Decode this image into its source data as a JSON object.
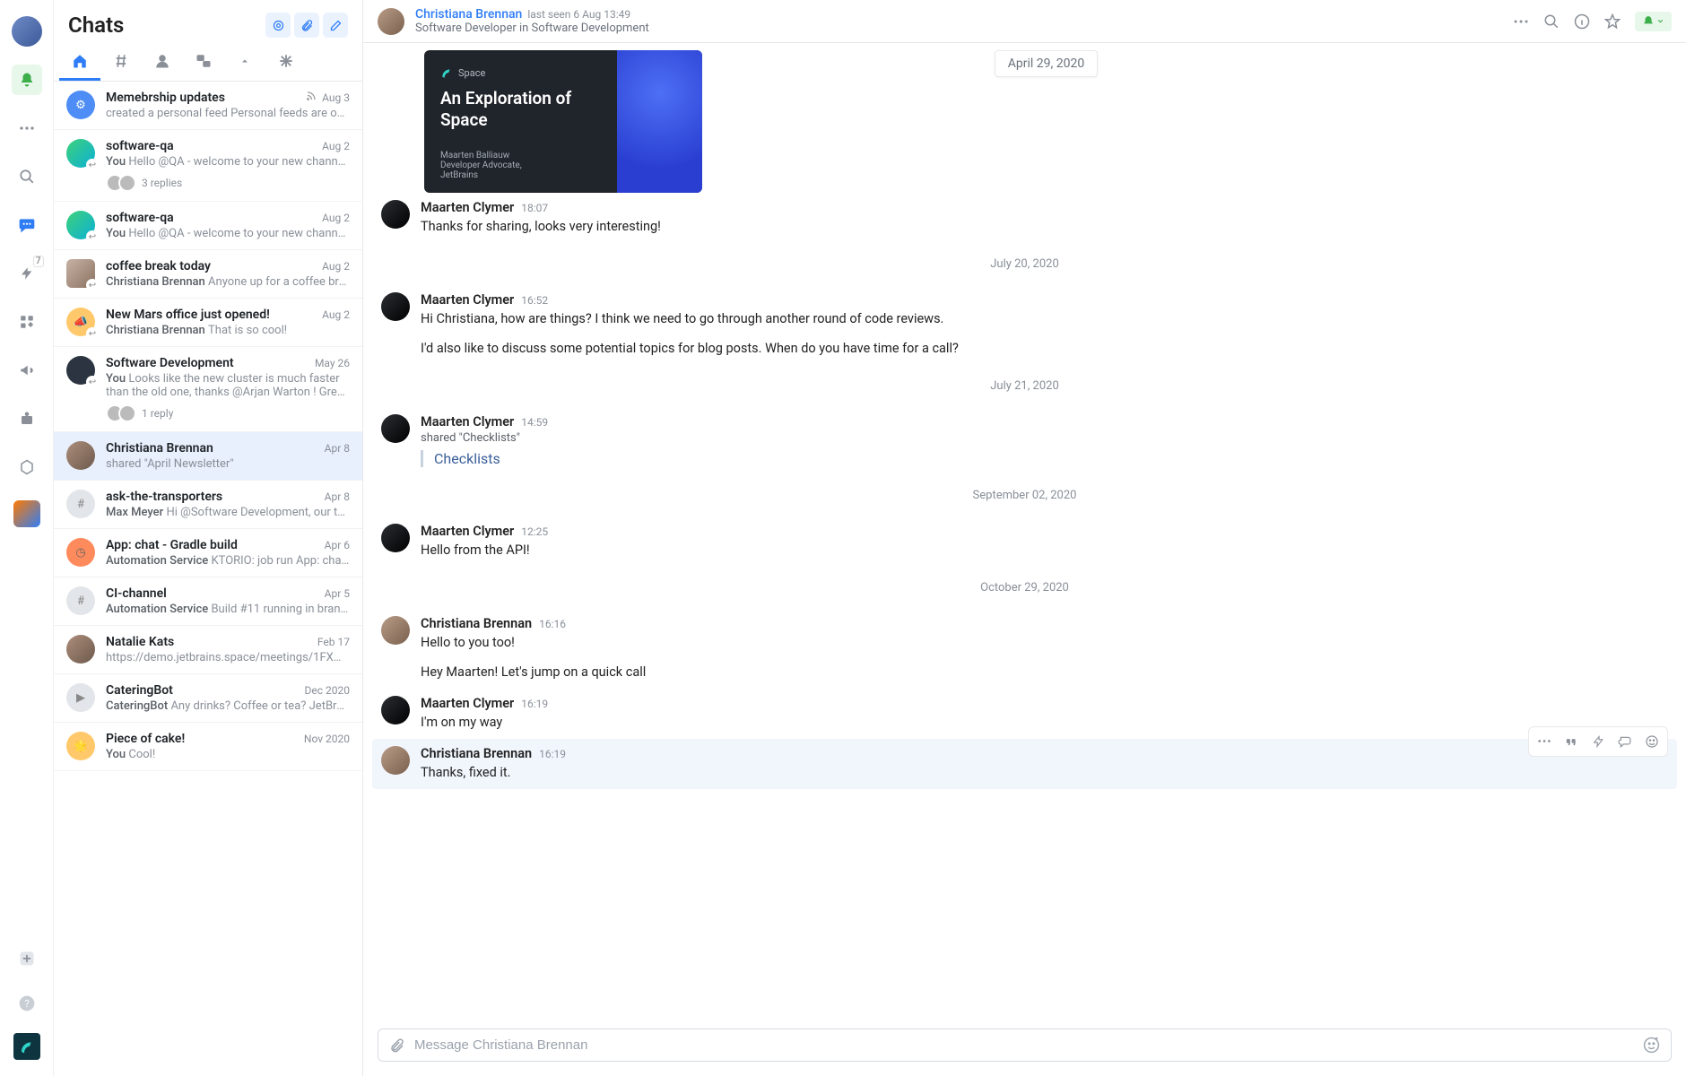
{
  "chatlist_title": "Chats",
  "rail": {
    "badge7": "7"
  },
  "tabs": [
    "home",
    "hash",
    "person",
    "group",
    "push",
    "asterisk"
  ],
  "chats": [
    {
      "title": "Memebrship updates",
      "date": "Aug 3",
      "rss": true,
      "snippet_author": "",
      "snippet": "created a personal feed Personal feeds are only…",
      "avatar": "blue",
      "icon": "⚙"
    },
    {
      "title": "software-qa",
      "date": "Aug 2",
      "snippet_author": "You",
      "snippet": "Hello @QA - welcome to your new channel!",
      "avatar": "green",
      "replies": "3 replies",
      "rep_avs": 2,
      "arrow": true
    },
    {
      "title": "software-qa",
      "date": "Aug 2",
      "snippet_author": "You",
      "snippet": "Hello @QA - welcome to your new channel!",
      "avatar": "green",
      "arrow": true
    },
    {
      "title": "coffee break today",
      "date": "Aug 2",
      "snippet_author": "Christiana Brennan",
      "snippet": "Anyone up for a coffee brea…",
      "avatar": "multi",
      "arrow": true
    },
    {
      "title": "New Mars office just opened!",
      "date": "Aug 2",
      "snippet_author": "Christiana Brennan",
      "snippet": "That is so cool!",
      "avatar": "orange",
      "icon": "📣",
      "arrow": true
    },
    {
      "title": "Software Development",
      "date": "May 26",
      "snippet_author": "You",
      "snippet": "Looks like the new cluster is much faster than the old one, thanks @Arjan Warton ! Great job!",
      "avatar": "dark",
      "replies": "1 reply",
      "rep_avs": 2,
      "arrow": true,
      "multiline": true
    },
    {
      "title": "Christiana Brennan",
      "date": "Apr 8",
      "snippet_author": "",
      "snippet": "shared \"April Newsletter\"",
      "avatar": "person",
      "selected": true
    },
    {
      "title": "ask-the-transporters",
      "date": "Apr 8",
      "snippet_author": "Max Meyer",
      "snippet": "Hi @Software Development, our tea…",
      "avatar": "gray",
      "icon": "#"
    },
    {
      "title": "App: chat - Gradle build",
      "date": "Apr 6",
      "snippet_author": "Automation Service",
      "snippet": "KTORIO: job run App: chat …",
      "avatar": "red",
      "icon": "◷"
    },
    {
      "title": "CI-channel",
      "date": "Apr 5",
      "snippet_author": "Automation Service",
      "snippet": "Build #11 running in branch…",
      "avatar": "gray",
      "icon": "#"
    },
    {
      "title": "Natalie Kats",
      "date": "Feb 17",
      "snippet_author": "",
      "snippet": "https://demo.jetbrains.space/meetings/1FXMBc…",
      "avatar": "person"
    },
    {
      "title": "CateringBot",
      "date": "Dec 2020",
      "snippet_author": "CateringBot",
      "snippet": "Any drinks? Coffee or tea? JetBrai…",
      "avatar": "gray",
      "icon": "▶"
    },
    {
      "title": "Piece of cake!",
      "date": "Nov 2020",
      "snippet_author": "You",
      "snippet": "Cool!",
      "avatar": "orange",
      "icon": "🌟"
    }
  ],
  "conv_header": {
    "name": "Christiana Brennan",
    "seen": "last seen 6 Aug 13:49",
    "sub": "Software Developer in Software Development"
  },
  "date_chip": "April 29, 2020",
  "preview": {
    "title": "An Exploration of Space",
    "author": "Maarten Balliauw",
    "sub": "Developer Advocate,",
    "sub2": "JetBrains",
    "brand": "Space"
  },
  "messages": [
    {
      "av": "m1",
      "name": "Maarten Clymer",
      "time": "18:07",
      "text": "Thanks for sharing, looks very interesting!"
    },
    {
      "type": "date",
      "text": "July 20, 2020"
    },
    {
      "av": "m1",
      "name": "Maarten Clymer",
      "time": "16:52",
      "text": "Hi Christiana, how are things? I think we need to go through another round of code reviews.",
      "text2": "I'd also like to discuss some potential topics for blog posts. When do you have time for a call?"
    },
    {
      "type": "date",
      "text": "July 21, 2020"
    },
    {
      "av": "m1",
      "name": "Maarten Clymer",
      "time": "14:59",
      "shared": "shared \"Checklists\"",
      "link": "Checklists"
    },
    {
      "type": "date",
      "text": "September 02, 2020"
    },
    {
      "av": "m1",
      "name": "Maarten Clymer",
      "time": "12:25",
      "text": "Hello from the API!"
    },
    {
      "type": "date",
      "text": "October 29, 2020"
    },
    {
      "av": "m2",
      "name": "Christiana Brennan",
      "time": "16:16",
      "text": "Hello to you too!",
      "text2": "Hey Maarten! Let's jump on a quick call"
    },
    {
      "av": "m1",
      "name": "Maarten Clymer",
      "time": "16:19",
      "text": "I'm on my way"
    },
    {
      "av": "m2",
      "name": "Christiana Brennan",
      "time": "16:19",
      "text": "Thanks, fixed it.",
      "highlight": true
    }
  ],
  "composer_placeholder": "Message Christiana Brennan"
}
